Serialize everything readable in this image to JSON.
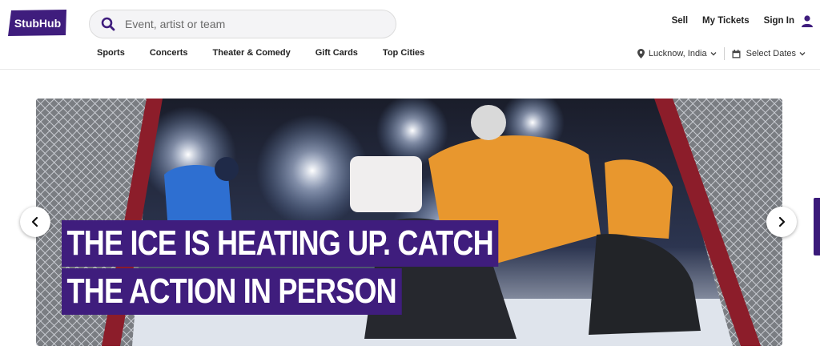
{
  "brand": {
    "logo_text": "StubHub",
    "color": "#3f1d7d"
  },
  "search": {
    "placeholder": "Event, artist or team",
    "icon": "search-icon"
  },
  "top_nav": {
    "sell": "Sell",
    "my_tickets": "My Tickets",
    "sign_in": "Sign In",
    "user_icon": "user-icon"
  },
  "categories": [
    "Sports",
    "Concerts",
    "Theater & Comedy",
    "Gift Cards",
    "Top Cities"
  ],
  "location": {
    "label": "Lucknow, India",
    "icon": "location-pin-icon"
  },
  "dates": {
    "label": "Select Dates",
    "icon": "calendar-icon"
  },
  "hero": {
    "headline_line1": "THE ICE IS HEATING UP. CATCH",
    "headline_line2": "THE ACTION IN PERSON",
    "headline_bg": "#3f1d7d"
  },
  "carousel": {
    "prev_icon": "chevron-left-icon",
    "next_icon": "chevron-right-icon"
  }
}
